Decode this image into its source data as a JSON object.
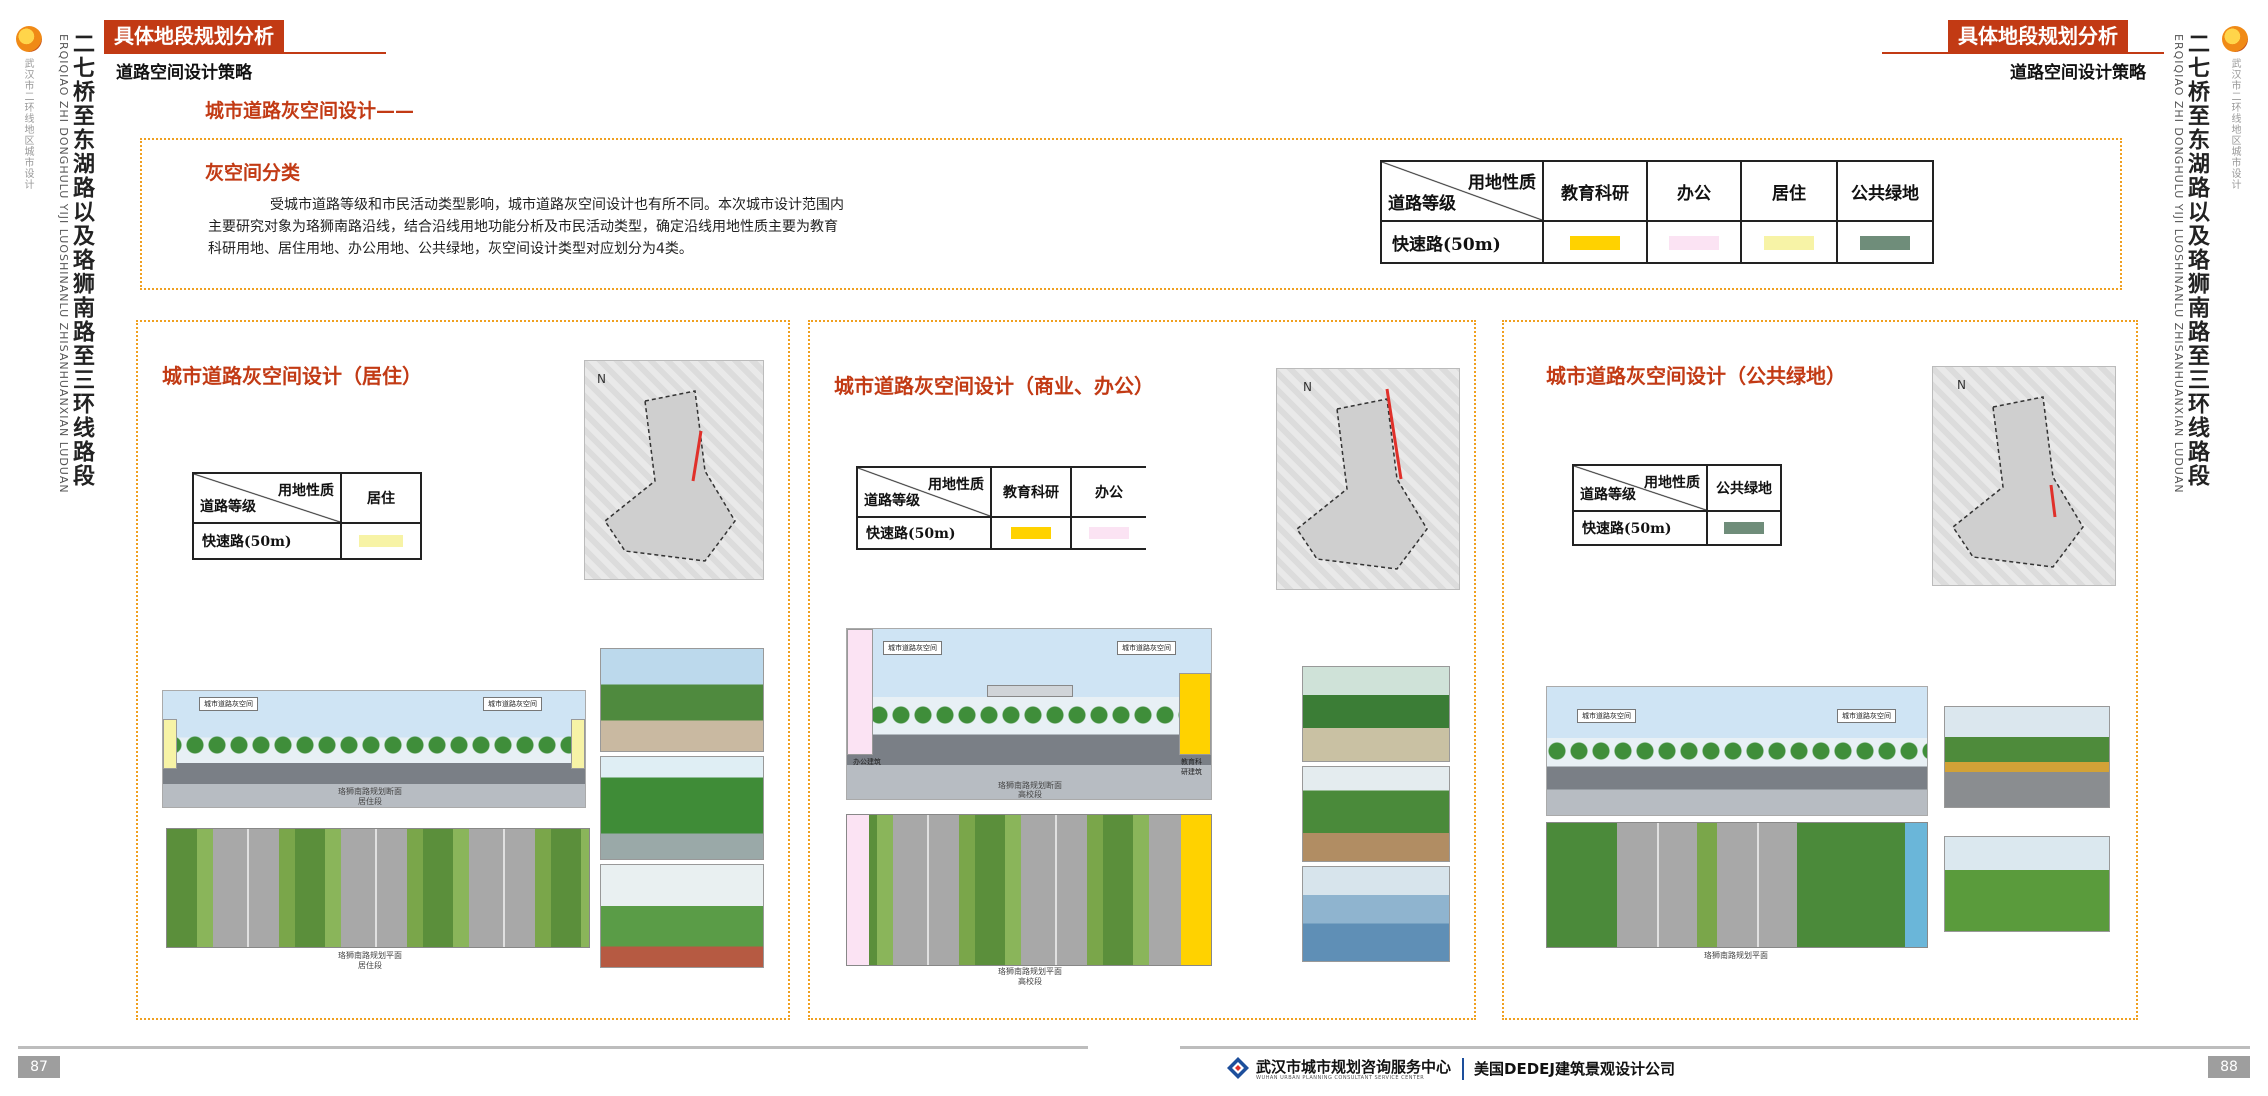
{
  "header": {
    "section_tag": "具体地段规划分析",
    "subtitle": "道路空间设计策略"
  },
  "side": {
    "title_vertical": "二七桥至东湖路以及珞狮南路至三环线路段",
    "pinyin_vertical": "ERQIQIAO ZHI DONGHULU YIJI LUOSHINANLU ZHISANHUANXIAN LUDUAN",
    "org_vertical": "武汉市二环线地区城市设计"
  },
  "main_heading": "城市道路灰空间设计——",
  "intro": {
    "heading": "灰空间分类",
    "lines": [
      "受城市道路等级和市民活动类型影响，城市道路灰空间设计也有所不同。本次城市设计范围内",
      "主要研究对象为珞狮南路沿线，结合沿线用地功能分析及市民活动类型，确定沿线用地性质主要为教育",
      "科研用地、居住用地、办公用地、公共绿地，灰空间设计类型对应划分为4类。"
    ]
  },
  "legend_table": {
    "corner_top": "用地性质",
    "corner_bottom": "道路等级",
    "row_label": "快速路(50m)",
    "columns": [
      {
        "label": "教育科研",
        "color": "#ffd200"
      },
      {
        "label": "办公",
        "color": "#fbe3f3"
      },
      {
        "label": "居住",
        "color": "#f7f3a6"
      },
      {
        "label": "公共绿地",
        "color": "#6f8d7a"
      }
    ]
  },
  "panels": [
    {
      "title": "城市道路灰空间设计（居住）",
      "table": {
        "corner_top": "用地性质",
        "corner_bottom": "道路等级",
        "row_label": "快速路(50m)",
        "columns": [
          {
            "label": "居住",
            "color": "#f7f3a6"
          }
        ]
      },
      "section_tags": [
        "城市道路灰空间",
        "城市道路灰空间"
      ],
      "section_caption": "珞狮南路规划断面",
      "section_sub": "居住段",
      "plan_caption": "珞狮南路规划平面",
      "plan_sub": "居住段"
    },
    {
      "title": "城市道路灰空间设计（商业、办公）",
      "table": {
        "corner_top": "用地性质",
        "corner_bottom": "道路等级",
        "row_label": "快速路(50m)",
        "columns": [
          {
            "label": "教育科研",
            "color": "#ffd200"
          },
          {
            "label": "办公",
            "color": "#fbe3f3"
          }
        ]
      },
      "section_tags": [
        "城市道路灰空间",
        "城市道路灰空间"
      ],
      "section_side_left": "办公建筑",
      "section_side_right": "教育科研建筑",
      "section_caption": "珞狮南路规划断面",
      "section_sub": "高校段",
      "plan_caption": "珞狮南路规划平面",
      "plan_sub": "高校段"
    },
    {
      "title": "城市道路灰空间设计（公共绿地）",
      "table": {
        "corner_top": "用地性质",
        "corner_bottom": "道路等级",
        "row_label": "快速路(50m)",
        "columns": [
          {
            "label": "公共绿地",
            "color": "#6f8d7a"
          }
        ]
      },
      "section_tags": [
        "城市道路灰空间",
        "城市道路灰空间"
      ],
      "section_caption": "",
      "section_sub": "",
      "plan_caption": "珞狮南路规划平面",
      "plan_sub": ""
    }
  ],
  "footer": {
    "page_left": "87",
    "page_right": "88",
    "org1": "武汉市城市规划咨询服务中心",
    "org1_en": "WUHAN URBAN PLANNING CONSULTANT SERVICE CENTER",
    "org2": "美国DEDEJ建筑景观设计公司"
  },
  "colors": {
    "accent": "#c23a14",
    "dotted_border": "#f0a020"
  }
}
